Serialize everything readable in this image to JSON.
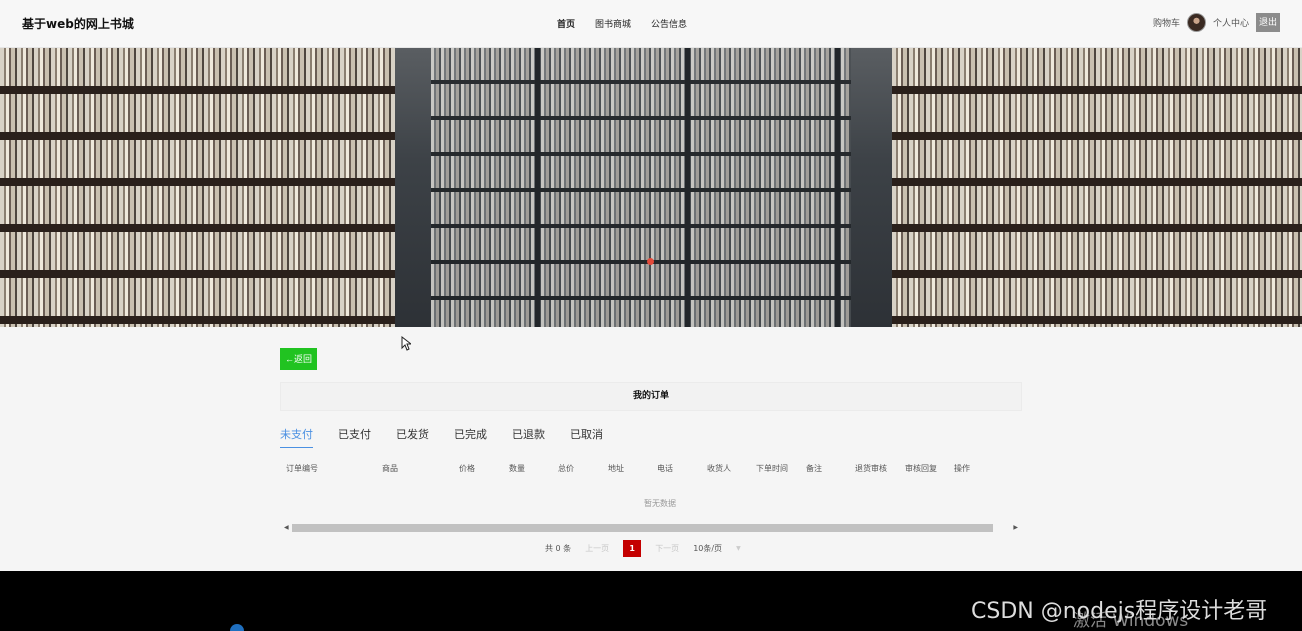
{
  "header": {
    "brand": "基于web的网上书城",
    "nav": [
      "首页",
      "图书商城",
      "公告信息"
    ],
    "cart": "购物车",
    "profile": "个人中心",
    "logout": "退出"
  },
  "content": {
    "back": "←返回",
    "title": "我的订单",
    "tabs": [
      "未支付",
      "已支付",
      "已发货",
      "已完成",
      "已退款",
      "已取消"
    ],
    "columns": [
      "订单编号",
      "商品",
      "价格",
      "数量",
      "总价",
      "地址",
      "电话",
      "收货人",
      "下单时间",
      "备注",
      "退货审核",
      "审核回复",
      "操作"
    ],
    "empty_text": "暂无数据"
  },
  "pagination": {
    "total": "共 0 条",
    "prev": "上一页",
    "current": "1",
    "next": "下一页",
    "page_size": "10条/页"
  },
  "overlay": {
    "watermark": "CSDN @nodejs程序设计老哥",
    "activate": "激活 Windows"
  },
  "colors": {
    "back_button": "#21c321",
    "active_tab": "#4a90e2",
    "current_page": "#c40000"
  }
}
